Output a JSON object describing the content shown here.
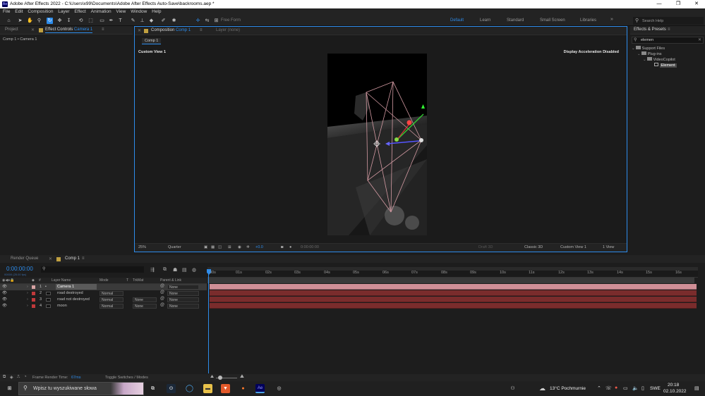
{
  "window": {
    "title": "Adobe After Effects 2022 - C:\\Users\\x99\\Documents\\Adobe After Effects Auto-Save\\backrooms.aep *",
    "logo": "Ae",
    "minimize": "—",
    "maximize": "❐",
    "close": "✕"
  },
  "menu": [
    "File",
    "Edit",
    "Composition",
    "Layer",
    "Effect",
    "Animation",
    "View",
    "Window",
    "Help"
  ],
  "toolbar": {
    "free_form": "Free Form",
    "workspaces": [
      "Default",
      "Learn",
      "Standard",
      "Small Screen",
      "Libraries"
    ],
    "active_workspace": "Default",
    "more": "»",
    "search_placeholder": "Search Help"
  },
  "left_panel": {
    "tab_project": "Project",
    "tab_effect_controls": "Effect Controls",
    "tab_effect_target": "Camera 1",
    "subtitle": "Comp 1 • Camera 1"
  },
  "composition_panel": {
    "tab_label": "Composition",
    "tab_comp": "Comp 1",
    "tab_layer": "Layer (none)",
    "breadcrumb": "Comp 1",
    "view_label": "Custom View 1",
    "accel_notice": "Display Acceleration Disabled",
    "footer": {
      "zoom": "25%",
      "resolution": "Quarter",
      "exposure": "+0.0",
      "timecode": "0:00:00:00",
      "draft3d": "Draft 3D",
      "renderer": "Classic 3D",
      "view": "Custom View 1",
      "view_count": "1 View"
    }
  },
  "effects_presets": {
    "title": "Effects & Presets",
    "search_value": "elemen",
    "tree": [
      {
        "label": "Support Files",
        "indent": 0
      },
      {
        "label": "Plug-ins",
        "indent": 1
      },
      {
        "label": "VideoCopilot",
        "indent": 2
      },
      {
        "label": "Element",
        "indent": 3
      }
    ]
  },
  "timeline": {
    "tab_render": "Render Queue",
    "tab_comp": "Comp 1",
    "timecode": "0:00:00:00",
    "fps": "00000 (25.00 fps)",
    "columns": {
      "layer_name": "Layer Name",
      "mode": "Mode",
      "t": "T",
      "trkmat": "TrkMat",
      "parent": "Parent & Link"
    },
    "layers": [
      {
        "num": "1",
        "name": "Camera 1",
        "mode": "",
        "trkmat": "",
        "parent": "None",
        "color": "#d9a4a4"
      },
      {
        "num": "2",
        "name": "road destroyed",
        "mode": "Normal",
        "trkmat": "",
        "parent": "None",
        "color": "#c0393b"
      },
      {
        "num": "3",
        "name": "road not destroyed",
        "mode": "Normal",
        "trkmat": "None",
        "parent": "None",
        "color": "#c0393b"
      },
      {
        "num": "4",
        "name": "moon",
        "mode": "Normal",
        "trkmat": "None",
        "parent": "None",
        "color": "#c0393b"
      }
    ],
    "ruler": [
      "00s",
      "01s",
      "02s",
      "03s",
      "04s",
      "05s",
      "06s",
      "07s",
      "08s",
      "09s",
      "10s",
      "11s",
      "12s",
      "13s",
      "14s",
      "15s",
      "16s"
    ],
    "frame_render_label": "Frame Render Time:",
    "frame_render_value": "67ms",
    "toggle_label": "Toggle Switches / Modes"
  },
  "taskbar": {
    "search_placeholder": "Wpisz tu wyszukiwane słowa",
    "weather": "13°C  Pochmurnie",
    "language": "SWE",
    "time": "20:18",
    "date": "02.10.2022"
  },
  "colors": {
    "accent": "#2d8ceb",
    "track": "#7a2c2c",
    "camera_track": "#d08f97"
  }
}
